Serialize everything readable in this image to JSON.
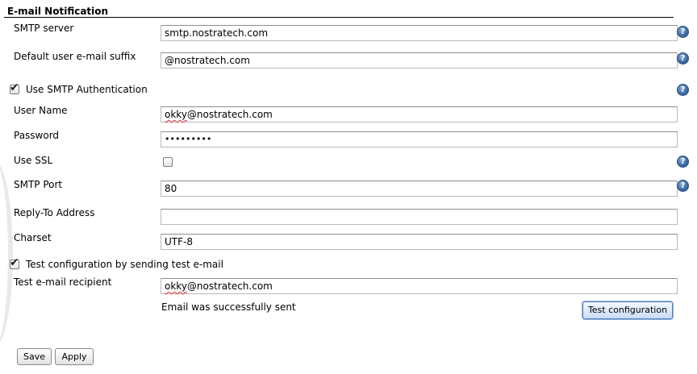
{
  "section": {
    "title": "E-mail Notification"
  },
  "fields": {
    "smtp_server": {
      "label": "SMTP server",
      "value": "smtp.nostratech.com"
    },
    "default_suffix": {
      "label": "Default user e-mail suffix",
      "value": "@nostratech.com"
    },
    "use_smtp_auth": {
      "label": "Use SMTP Authentication",
      "checked": true
    },
    "user_name": {
      "label": "User Name",
      "value_prefix": "okky",
      "value_rest": "@nostratech.com"
    },
    "password": {
      "label": "Password",
      "value": "•••••••••"
    },
    "use_ssl": {
      "label": "Use SSL",
      "checked": false
    },
    "smtp_port": {
      "label": "SMTP Port",
      "value": "80"
    },
    "reply_to": {
      "label": "Reply-To Address",
      "value": ""
    },
    "charset": {
      "label": "Charset",
      "value": "UTF-8"
    },
    "test_config": {
      "label": "Test configuration by sending test e-mail",
      "checked": true
    },
    "test_recipient": {
      "label": "Test e-mail recipient",
      "value_prefix": "okky",
      "value_rest": "@nostratech.com"
    }
  },
  "status": {
    "message": "Email was successfully sent"
  },
  "buttons": {
    "test_configuration": "Test configuration",
    "save": "Save",
    "apply": "Apply"
  },
  "help_icon_glyph": "?",
  "check_glyph": "✔",
  "colors": {
    "help_icon": "#3f6fa6",
    "primary_button_border": "#5b7fb8",
    "spellcheck_underline": "#e0303a"
  }
}
